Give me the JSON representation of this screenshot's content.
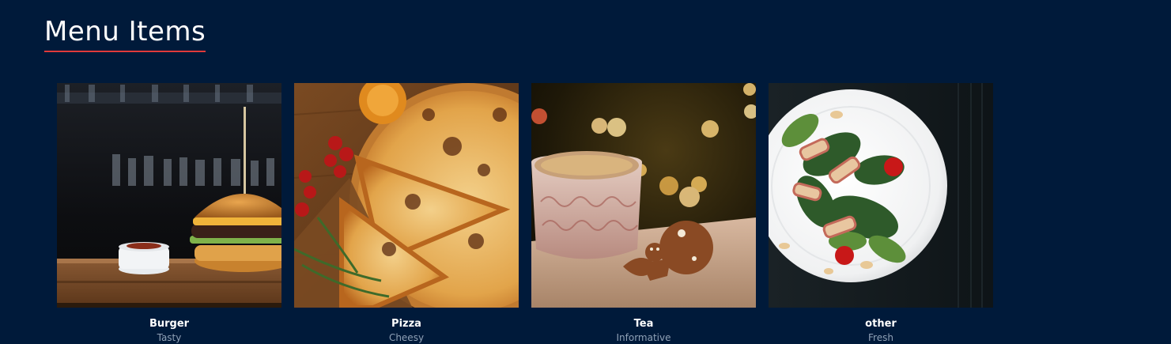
{
  "section": {
    "title": "Menu Items",
    "underline_color": "#e03a3a"
  },
  "items": [
    {
      "name": "Burger",
      "description": "Tasty",
      "image": "burger-photo"
    },
    {
      "name": "Pizza",
      "description": "Cheesy",
      "image": "pizza-photo"
    },
    {
      "name": "Tea",
      "description": "Informative",
      "image": "tea-photo"
    },
    {
      "name": "other",
      "description": "Fresh",
      "image": "salad-photo"
    }
  ],
  "colors": {
    "background": "#001a3a",
    "text": "#ffffff",
    "muted_text": "#8fa1b6"
  }
}
